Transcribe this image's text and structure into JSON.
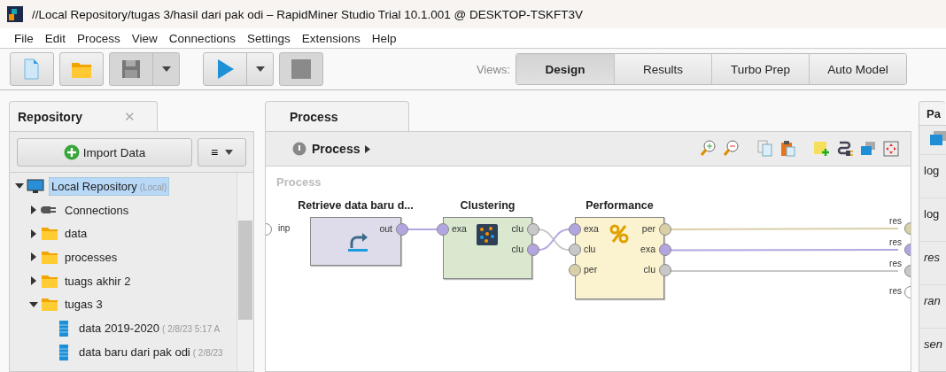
{
  "window": {
    "title": "//Local Repository/tugas 3/hasil dari pak odi – RapidMiner Studio Trial 10.1.001 @ DESKTOP-TSKFT3V"
  },
  "menu": [
    {
      "label": "File"
    },
    {
      "label": "Edit"
    },
    {
      "label": "Process"
    },
    {
      "label": "View"
    },
    {
      "label": "Connections"
    },
    {
      "label": "Settings"
    },
    {
      "label": "Extensions"
    },
    {
      "label": "Help"
    }
  ],
  "toolbar": [
    {
      "kind": "new",
      "disabled": false,
      "dropdown": false
    },
    {
      "kind": "open",
      "disabled": false,
      "dropdown": false
    },
    {
      "kind": "save",
      "disabled": true,
      "dropdown": true
    },
    {
      "kind": "run",
      "disabled": false,
      "dropdown": true
    },
    {
      "kind": "stop",
      "disabled": true,
      "dropdown": false
    }
  ],
  "views": {
    "label": "Views:",
    "tabs": [
      {
        "label": "Design",
        "selected": true
      },
      {
        "label": "Results",
        "selected": false
      },
      {
        "label": "Turbo Prep",
        "selected": false
      },
      {
        "label": "Auto Model",
        "selected": false
      }
    ]
  },
  "repository": {
    "tab": "Repository",
    "close": "✕",
    "import_button": "Import Data",
    "menu_button": "≡",
    "tree": [
      {
        "label": "Local Repository",
        "meta": "(Local)",
        "kind": "repository",
        "expanded": true,
        "selected": true,
        "children": [
          {
            "label": "Connections",
            "kind": "connections",
            "expanded": false,
            "selected": false
          },
          {
            "label": "data",
            "kind": "folder",
            "expanded": false,
            "selected": false
          },
          {
            "label": "processes",
            "kind": "folder",
            "expanded": false,
            "selected": false
          },
          {
            "label": "tuags akhir 2",
            "kind": "folder",
            "expanded": false,
            "selected": false
          },
          {
            "label": "tugas 3",
            "kind": "folder",
            "expanded": true,
            "selected": false,
            "children": [
              {
                "label": "data 2019-2020",
                "meta": "( 2/8/23 5:17 A",
                "kind": "data",
                "selected": false
              },
              {
                "label": "data baru dari pak odi",
                "meta": "( 2/8/23",
                "kind": "data",
                "selected": false
              }
            ]
          }
        ]
      }
    ]
  },
  "process": {
    "tab": "Process",
    "breadcrumb": "Process",
    "canvas_label": "Process",
    "input_ports": [
      {
        "label": "inp"
      }
    ],
    "operators": [
      {
        "name": "Retrieve data baru d...",
        "kind": "retrieve",
        "out": [
          {
            "label": "out",
            "color": "#b3a6e0"
          }
        ]
      },
      {
        "name": "Clustering",
        "kind": "clustering",
        "in": [
          {
            "label": "exa",
            "color": "#b3a6e0"
          }
        ],
        "out": [
          {
            "label": "clu",
            "color": "#c8c8c8"
          },
          {
            "label": "clu",
            "color": "#b3a6e0"
          }
        ]
      },
      {
        "name": "Performance",
        "kind": "performance",
        "in": [
          {
            "label": "exa",
            "color": "#b3a6e0"
          },
          {
            "label": "clu",
            "color": "#c8c8c8"
          },
          {
            "label": "per",
            "color": "#d9d0a8"
          }
        ],
        "out": [
          {
            "label": "per",
            "color": "#d9d0a8"
          },
          {
            "label": "exa",
            "color": "#b3a6e0"
          },
          {
            "label": "clu",
            "color": "#c8c8c8"
          }
        ]
      }
    ],
    "result_ports": [
      {
        "label": "res",
        "color": "#d9d0a8"
      },
      {
        "label": "res",
        "color": "#b3a6e0"
      },
      {
        "label": "res",
        "color": "#c8c8c8"
      },
      {
        "label": "res",
        "color": "#ffffff"
      }
    ]
  },
  "parameters": {
    "tab": "Pa",
    "items": [
      {
        "label": "log",
        "expert": false
      },
      {
        "label": "log",
        "expert": false
      },
      {
        "label": "res",
        "expert": true
      },
      {
        "label": "ran",
        "expert": true
      },
      {
        "label": "sen",
        "expert": true
      }
    ]
  }
}
